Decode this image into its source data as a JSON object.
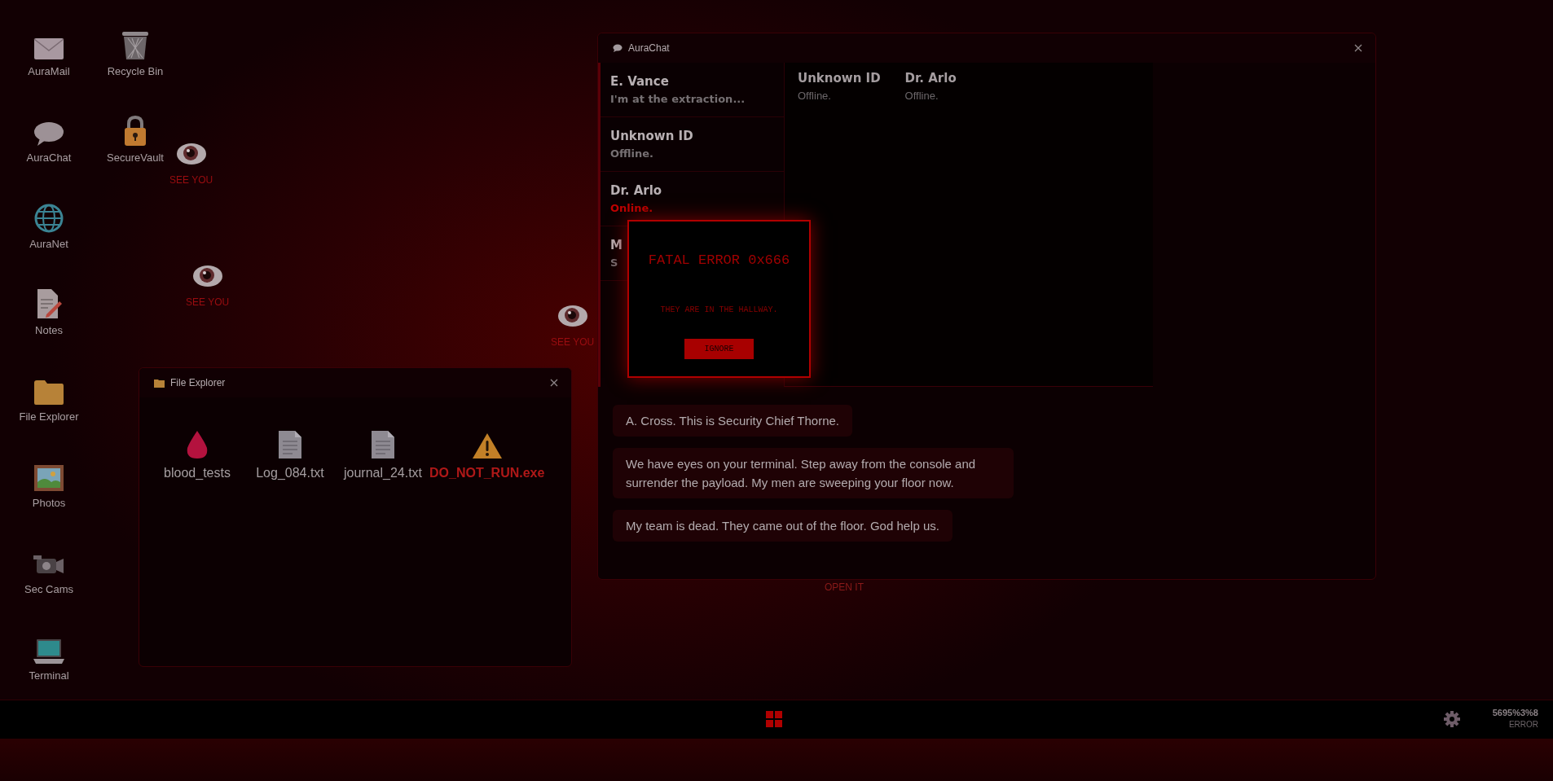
{
  "desktop_icons": [
    {
      "label": "AuraMail",
      "kind": "mail"
    },
    {
      "label": "AuraChat",
      "kind": "chat"
    },
    {
      "label": "AuraNet",
      "kind": "globe"
    },
    {
      "label": "Notes",
      "kind": "notes"
    },
    {
      "label": "File Explorer",
      "kind": "folder"
    },
    {
      "label": "Photos",
      "kind": "photo"
    },
    {
      "label": "Sec Cams",
      "kind": "camera"
    },
    {
      "label": "Terminal",
      "kind": "laptop"
    },
    {
      "label": "Recycle Bin",
      "kind": "trash"
    },
    {
      "label": "SecureVault",
      "kind": "lock"
    }
  ],
  "eyes": [
    {
      "label": "SEE YOU"
    },
    {
      "label": "SEE YOU"
    },
    {
      "label": "SEE YOU"
    }
  ],
  "hidden_item": {
    "label": "OPEN IT"
  },
  "chat_window": {
    "title": "AuraChat",
    "contacts": [
      {
        "name": "E. Vance",
        "status": "I'm at the extraction...",
        "online": false
      },
      {
        "name": "Unknown ID",
        "status": "Offline.",
        "online": false
      },
      {
        "name": "Dr. Arlo",
        "status": "Online.",
        "online": true
      },
      {
        "name": "M",
        "status": "S",
        "online": false
      }
    ],
    "header_contacts": [
      {
        "name": "Unknown ID",
        "status": "Offline."
      },
      {
        "name": "Dr. Arlo",
        "status": "Offline."
      }
    ],
    "messages": [
      "A. Cross. This is Security Chief Thorne.",
      "We have eyes on your terminal. Step away from the console and surrender the payload. My men are sweeping your floor now.",
      "My team is dead. They came out of the floor. God help us."
    ]
  },
  "error_dialog": {
    "title": "FATAL ERROR 0x666",
    "message": "THEY ARE IN THE HALLWAY.",
    "button": "IGNORE"
  },
  "file_explorer": {
    "title": "File Explorer",
    "files": [
      {
        "name": "blood_tests",
        "kind": "blood"
      },
      {
        "name": "Log_084.txt",
        "kind": "text"
      },
      {
        "name": "journal_24.txt",
        "kind": "text"
      },
      {
        "name": "DO_NOT_RUN.exe",
        "kind": "warning"
      }
    ]
  },
  "taskbar": {
    "clock": "5695%3%8",
    "date": "ERROR"
  }
}
